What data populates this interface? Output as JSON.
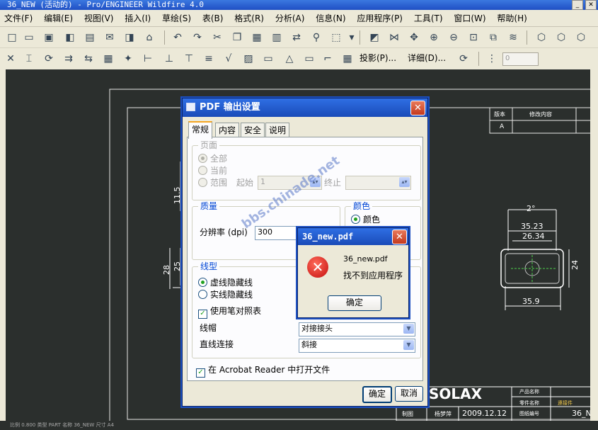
{
  "window": {
    "title": "36_NEW (活动的) - Pro/ENGINEER Wildfire 4.0",
    "minimize": "_",
    "close": "✕"
  },
  "menu": [
    "文件(F)",
    "编辑(E)",
    "视图(V)",
    "插入(I)",
    "草绘(S)",
    "表(B)",
    "格式(R)",
    "分析(A)",
    "信息(N)",
    "应用程序(P)",
    "工具(T)",
    "窗口(W)",
    "帮助(H)"
  ],
  "toolbar": {
    "projection_label": "投影(P)...",
    "detail_label": "详细(D)...",
    "value_field": "0"
  },
  "drawing": {
    "revision_header": "版本",
    "revision_desc_header": "修改内容",
    "revision_value": "A",
    "dim_2": "2°",
    "dim_35_23": "35.23",
    "dim_26_34": "26.34",
    "dim_35_9": "35.9",
    "dim_24": "24",
    "dim_11_5": "11.5",
    "dim_28": "28",
    "dim_25": "25",
    "company": "SOLAX",
    "product_name_label": "产品名称",
    "part_name_label": "零件名称",
    "drawing_no_label": "图纸编号",
    "drawn_by_label": "制图",
    "drawn_by_name": "杨梦萍",
    "date": "2009.12.12",
    "part_name_value": "連接件",
    "drawing_no_value": "36_N"
  },
  "status": "比例 0.800   类型 PART   名称 36_NEW   尺寸 A4",
  "pdf_dialog": {
    "title": "PDF 输出设置",
    "tabs": [
      "常规",
      "内容",
      "安全",
      "说明"
    ],
    "page_group": "页面",
    "page_all": "全部",
    "page_current": "当前",
    "page_range": "范围",
    "start_label": "起始",
    "start_value": "1",
    "end_label": "终止",
    "quality_group": "质量",
    "resolution_label": "分辨率 (dpi)",
    "resolution_value": "300",
    "color_group": "颜色",
    "color_option": "颜色",
    "line_group": "线型",
    "dashed_hidden": "虚线隐藏线",
    "solid_hidden": "实线隐藏线",
    "use_pen_table": "使用笔对照表",
    "line_cap_label": "线帽",
    "line_cap_value": "对接接头",
    "line_join_label": "直线连接",
    "line_join_value": "斜接",
    "open_in_acrobat": "在 Acrobat Reader 中打开文件",
    "ok": "确定",
    "cancel": "取消"
  },
  "error_dialog": {
    "title": "36_new.pdf",
    "filename": "36_new.pdf",
    "message": "找不到应用程序",
    "ok": "确定"
  },
  "watermark": "bbs.chinade.net"
}
